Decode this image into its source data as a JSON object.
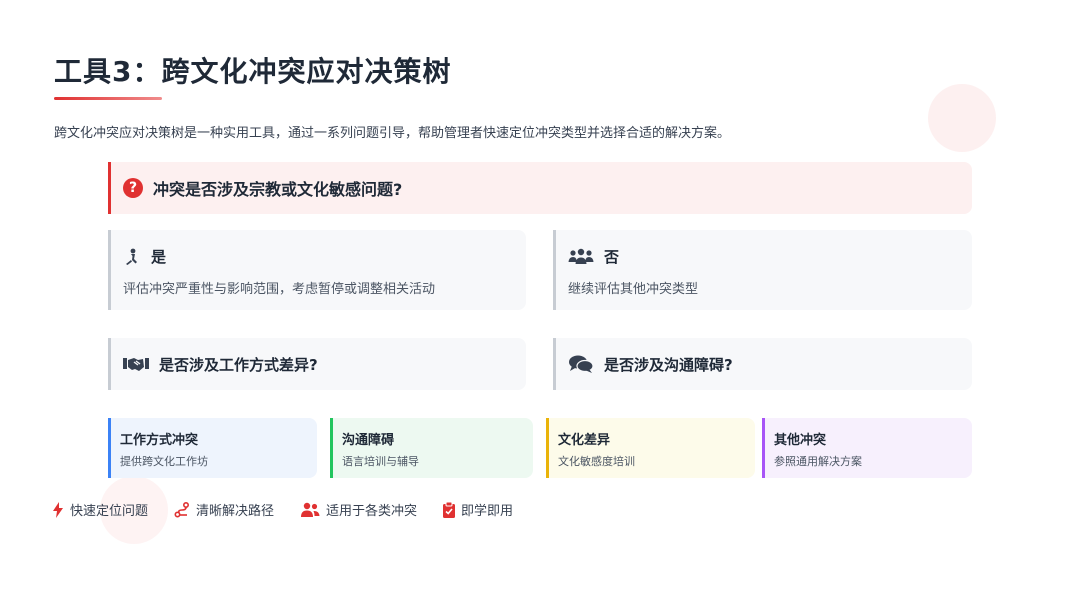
{
  "title": "工具3：跨文化冲突应对决策树",
  "intro": "跨文化冲突应对决策树是一种实用工具，通过一系列问题引导，帮助管理者快速定位冲突类型并选择合适的解决方案。",
  "main_question": {
    "icon": "question-circle-icon",
    "text": "冲突是否涉及宗教或文化敏感问题?"
  },
  "branches": [
    {
      "icon": "praying-person-icon",
      "label": "是",
      "description": "评估冲突严重性与影响范围，考虑暂停或调整相关活动"
    },
    {
      "icon": "people-group-icon",
      "label": "否",
      "description": "继续评估其他冲突类型"
    }
  ],
  "sub_questions": [
    {
      "icon": "handshake-icon",
      "text": "是否涉及工作方式差异?"
    },
    {
      "icon": "chat-bubbles-icon",
      "text": "是否涉及沟通障碍?"
    }
  ],
  "leaves": [
    {
      "title": "工作方式冲突",
      "description": "提供跨文化工作坊",
      "color": "#3b82f6"
    },
    {
      "title": "沟通障碍",
      "description": "语言培训与辅导",
      "color": "#22c55e"
    },
    {
      "title": "文化差异",
      "description": "文化敏感度培训",
      "color": "#eab308"
    },
    {
      "title": "其他冲突",
      "description": "参照通用解决方案",
      "color": "#a855f7"
    }
  ],
  "features": [
    {
      "icon": "bolt-icon",
      "label": "快速定位问题"
    },
    {
      "icon": "route-icon",
      "label": "清晰解决路径"
    },
    {
      "icon": "users-icon",
      "label": "适用于各类冲突"
    },
    {
      "icon": "clipboard-check-icon",
      "label": "即学即用"
    }
  ],
  "colors": {
    "accent": "#e03131",
    "text": "#1f2937",
    "card_bg": "#f7f8fa"
  }
}
